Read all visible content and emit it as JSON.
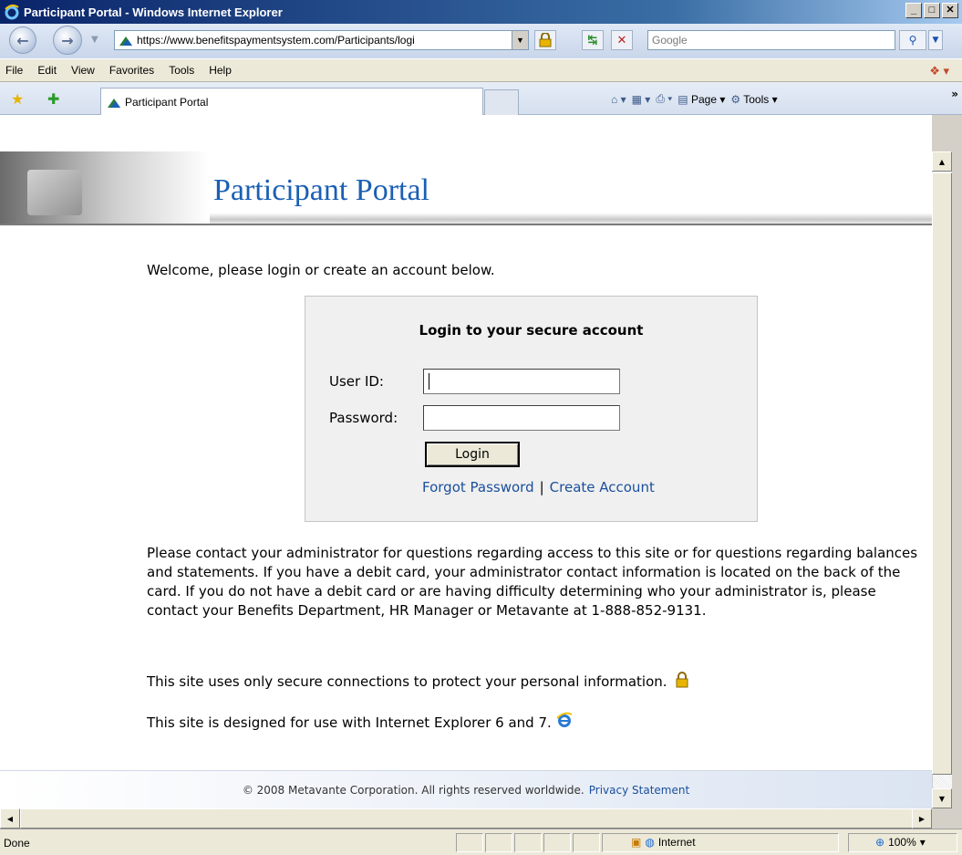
{
  "window": {
    "title": "Participant Portal - Windows Internet Explorer",
    "controls": {
      "minimize": "_",
      "maximize": "□",
      "close": "✕"
    }
  },
  "address_bar": {
    "url": "https://www.benefitspaymentsystem.com/Participants/logi",
    "search_placeholder": "Google"
  },
  "menu": [
    "File",
    "Edit",
    "View",
    "Favorites",
    "Tools",
    "Help"
  ],
  "tab": {
    "label": "Participant Portal"
  },
  "command_bar": {
    "page_label": "Page",
    "tools_label": "Tools"
  },
  "page": {
    "banner_title": "Participant Portal",
    "welcome": "Welcome, please login or create an account below.",
    "login": {
      "title": "Login to your secure account",
      "user_id_label": "User ID:",
      "password_label": "Password:",
      "user_id_value": "",
      "password_value": "",
      "button_label": "Login",
      "forgot_password": "Forgot Password",
      "separator": "|",
      "create_account": "Create Account"
    },
    "contact_paragraph": "Please contact your administrator for questions regarding access to this site or for questions regarding balances and statements. If you have a debit card, your administrator contact information is located on the back of the card. If you do not have a debit card or are having difficulty determining who your administrator is, please contact your Benefits Department, HR Manager or Metavante at 1-888-852-9131.",
    "secure_note": "This site uses only secure connections to protect your personal information.",
    "ie_note": "This site is designed for use with Internet Explorer 6 and 7.",
    "footer": {
      "copyright": "© 2008 Metavante Corporation. All rights reserved worldwide.",
      "privacy_link": "Privacy Statement"
    }
  },
  "status_bar": {
    "status": "Done",
    "zone": "Internet",
    "zoom": "100%"
  }
}
